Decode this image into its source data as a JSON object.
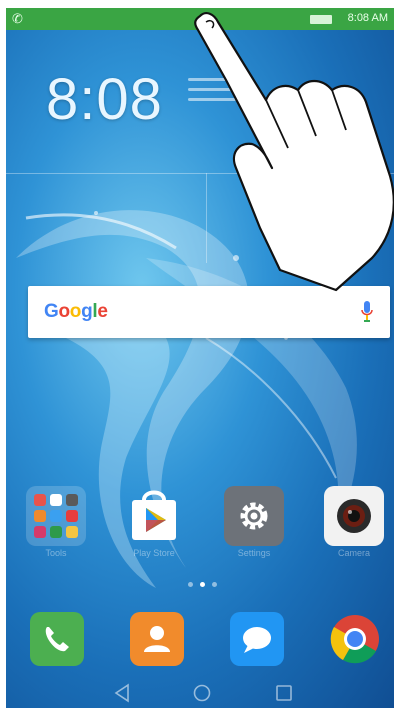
{
  "statusbar": {
    "time": "8:08 AM",
    "phone_icon": "phone-icon",
    "battery_icon": "battery-icon"
  },
  "widget": {
    "clock": "8:08",
    "weather_icon": "partly-cloudy-icon"
  },
  "search": {
    "logo": "Google",
    "mic_icon": "mic-icon"
  },
  "apps": [
    {
      "name": "Tools",
      "icon": "folder-icon"
    },
    {
      "name": "Play Store",
      "icon": "play-store-icon"
    },
    {
      "name": "Settings",
      "icon": "gear-icon"
    },
    {
      "name": "Camera",
      "icon": "camera-icon"
    }
  ],
  "dock": [
    {
      "name": "Phone",
      "icon": "phone-icon"
    },
    {
      "name": "Contacts",
      "icon": "contacts-icon"
    },
    {
      "name": "Messaging",
      "icon": "message-icon"
    },
    {
      "name": "Chrome",
      "icon": "chrome-icon"
    }
  ],
  "navigation": {
    "back_icon": "back-icon",
    "home_icon": "home-icon",
    "recents_icon": "recents-icon"
  },
  "pager": {
    "pages": 3,
    "current": 2
  },
  "gesture": {
    "icon": "swipe-down-hand-icon"
  },
  "colors": {
    "status_bar": "#3aa544",
    "google_blue": "#4285f4",
    "google_red": "#ea4335",
    "google_yellow": "#fbbc05",
    "google_green": "#34a853"
  }
}
